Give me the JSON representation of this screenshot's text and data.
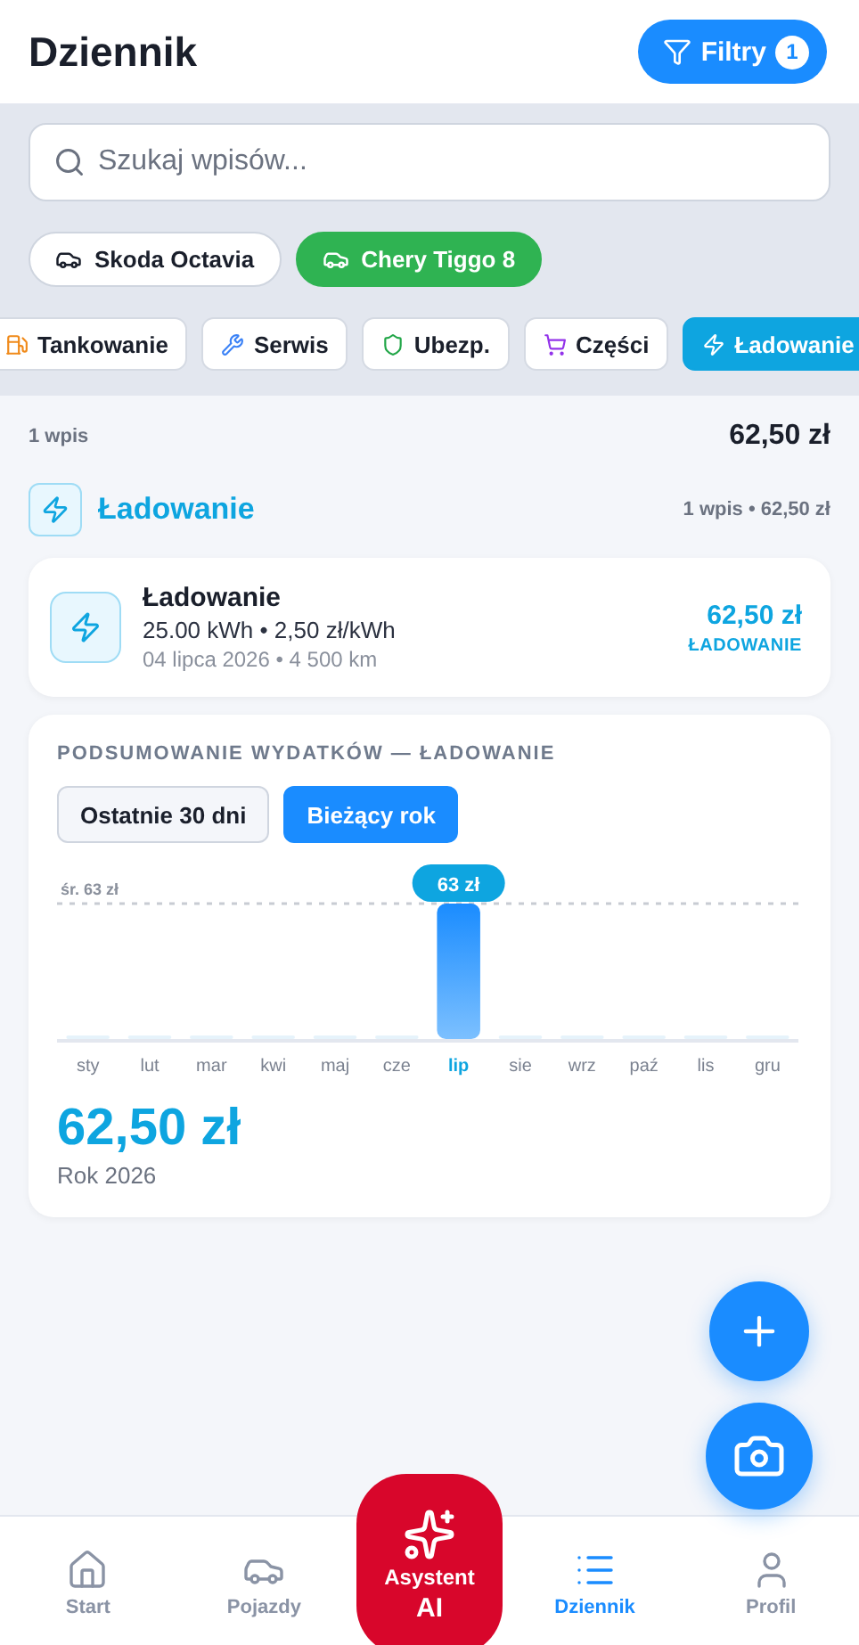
{
  "header": {
    "title": "Dziennik",
    "filter_button": {
      "label": "Filtry",
      "count": "1"
    }
  },
  "search": {
    "placeholder": "Szukaj wpisów..."
  },
  "vehicles": [
    {
      "label": "Skoda Octavia",
      "selected": false
    },
    {
      "label": "Chery Tiggo 8",
      "selected": true
    }
  ],
  "categories": [
    {
      "kind": "fuel",
      "label": "Tankowanie",
      "selected": false
    },
    {
      "kind": "service",
      "label": "Serwis",
      "selected": false
    },
    {
      "kind": "insurance",
      "label": "Ubezp.",
      "selected": false
    },
    {
      "kind": "parts",
      "label": "Części",
      "selected": false
    },
    {
      "kind": "charging",
      "label": "Ładowanie",
      "selected": true
    }
  ],
  "summary": {
    "count": "1 wpis",
    "total": "62,50 zł"
  },
  "group": {
    "title": "Ładowanie",
    "meta": "1 wpis • 62,50 zł"
  },
  "entries": [
    {
      "title": "Ładowanie",
      "details": "25.00 kWh • 2,50 zł/kWh",
      "date": "04 lipca 2026 • 4 500 km",
      "amount": "62,50 zł",
      "category": "ŁADOWANIE"
    }
  ],
  "expenses": {
    "title": "PODSUMOWANIE WYDATKÓW — ŁADOWANIE",
    "periods": [
      {
        "label": "Ostatnie 30 dni",
        "selected": false
      },
      {
        "label": "Bieżący rok",
        "selected": true
      }
    ],
    "chart": {
      "average_label": "śr. 63 zł",
      "months": [
        {
          "label": "sty",
          "selected": false
        },
        {
          "label": "lut",
          "selected": false
        },
        {
          "label": "mar",
          "selected": false
        },
        {
          "label": "kwi",
          "selected": false
        },
        {
          "label": "maj",
          "selected": false
        },
        {
          "label": "cze",
          "selected": false
        },
        {
          "label": "lip",
          "selected": true,
          "value_label": "63 zł"
        },
        {
          "label": "sie",
          "selected": false
        },
        {
          "label": "wrz",
          "selected": false
        },
        {
          "label": "paź",
          "selected": false
        },
        {
          "label": "lis",
          "selected": false
        },
        {
          "label": "gru",
          "selected": false
        }
      ]
    },
    "total": "62,50 zł",
    "period_label": "Rok 2026"
  },
  "nav": [
    {
      "kind": "home",
      "label": "Start",
      "selected": false
    },
    {
      "kind": "car",
      "label": "Pojazdy",
      "selected": false
    },
    {
      "kind": "ai",
      "label": "Asystent",
      "sublabel": "AI",
      "selected": false
    },
    {
      "kind": "list",
      "label": "Dziennik",
      "selected": true
    },
    {
      "kind": "user",
      "label": "Profil",
      "selected": false
    }
  ]
}
